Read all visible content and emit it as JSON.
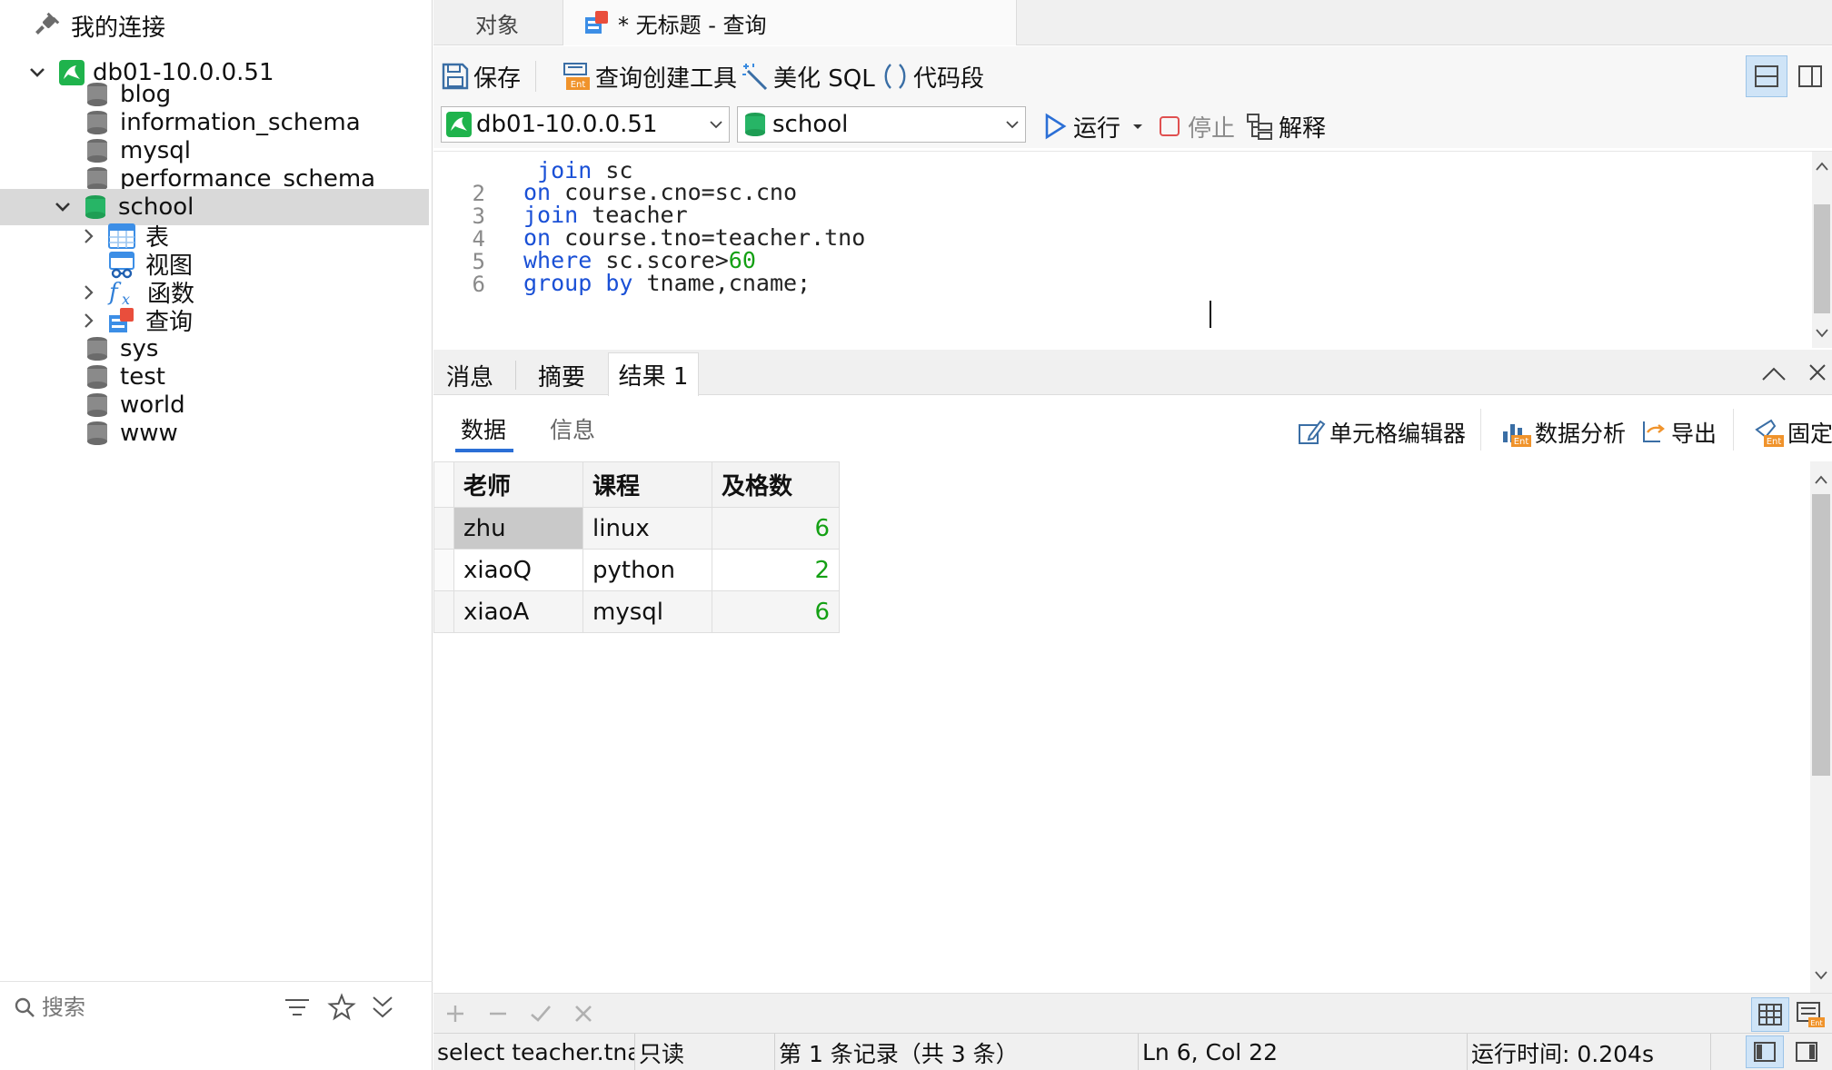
{
  "sidebar": {
    "root_label": "我的连接",
    "connection": {
      "label": "db01-10.0.0.51",
      "expanded": true
    },
    "databases": [
      {
        "label": "blog"
      },
      {
        "label": "information_schema"
      },
      {
        "label": "mysql"
      },
      {
        "label": "performance_schema"
      },
      {
        "label": "school",
        "expanded": true,
        "selected": true
      },
      {
        "label": "sys"
      },
      {
        "label": "test"
      },
      {
        "label": "world"
      },
      {
        "label": "www"
      }
    ],
    "school_children": [
      {
        "label": "表",
        "icon": "table-icon"
      },
      {
        "label": "视图",
        "icon": "view-icon"
      },
      {
        "label": "函数",
        "icon": "function-icon"
      },
      {
        "label": "查询",
        "icon": "query-icon"
      }
    ],
    "search_placeholder": "搜索"
  },
  "tabs": {
    "objects_label": "对象",
    "query_tab_label": "* 无标题 - 查询"
  },
  "toolbar": {
    "save_label": "保存",
    "query_builder_label": "查询创建工具",
    "beautify_label": "美化 SQL",
    "snippet_label": "代码段"
  },
  "connection_bar": {
    "connection_value": "db01-10.0.0.51",
    "database_value": "school",
    "run_label": "运行",
    "stop_label": "停止",
    "explain_label": "解释"
  },
  "editor": {
    "lines": [
      {
        "num": "",
        "parts": [
          {
            "t": " "
          },
          {
            "t": "join",
            "c": "kw"
          },
          {
            "t": " sc"
          }
        ]
      },
      {
        "num": "2",
        "parts": [
          {
            "t": "on",
            "c": "kw"
          },
          {
            "t": " course.cno=sc.cno"
          }
        ]
      },
      {
        "num": "3",
        "parts": [
          {
            "t": "join",
            "c": "kw"
          },
          {
            "t": " teacher"
          }
        ]
      },
      {
        "num": "4",
        "parts": [
          {
            "t": "on",
            "c": "kw"
          },
          {
            "t": " course.tno=teacher.tno"
          }
        ]
      },
      {
        "num": "5",
        "parts": [
          {
            "t": "where",
            "c": "kw"
          },
          {
            "t": " sc.score>"
          },
          {
            "t": "60",
            "c": "num"
          }
        ]
      },
      {
        "num": "6",
        "parts": [
          {
            "t": "group",
            "c": "kw"
          },
          {
            "t": " "
          },
          {
            "t": "by",
            "c": "kw"
          },
          {
            "t": " tname,cname;"
          }
        ]
      }
    ]
  },
  "result_tabs": {
    "message_label": "消息",
    "summary_label": "摘要",
    "result_label": "结果 1"
  },
  "subbar": {
    "data_label": "数据",
    "info_label": "信息",
    "cell_editor_label": "单元格编辑器",
    "analysis_label": "数据分析",
    "export_label": "导出",
    "pin_label": "固定"
  },
  "grid": {
    "columns": [
      "老师",
      "课程",
      "及格数"
    ],
    "rows": [
      [
        "zhu",
        "linux",
        "6"
      ],
      [
        "xiaoQ",
        "python",
        "2"
      ],
      [
        "xiaoA",
        "mysql",
        "6"
      ]
    ]
  },
  "statusbar": {
    "sql_preview": "select teacher.tname",
    "mode": "只读",
    "records": "第 1 条记录（共 3 条）",
    "cursor": "Ln 6, Col 22",
    "run_time": "运行时间: 0.204s"
  },
  "colors": {
    "keyword": "#1a50d6",
    "number": "#14a014",
    "accent": "#2b6fd6",
    "selection": "#d9d9d9"
  }
}
